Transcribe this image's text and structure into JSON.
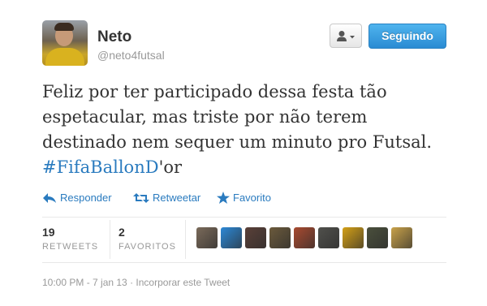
{
  "user": {
    "name": "Neto",
    "handle": "@neto4futsal"
  },
  "buttons": {
    "following": "Seguindo",
    "user_actions_icon": "person-dropdown-icon"
  },
  "tweet": {
    "text_before": "Feliz por ter participado dessa festa tão espetacular, mas triste por não terem destinado nem sequer um minuto pro Futsal. ",
    "hashtag": "#FifaBallonD",
    "text_after": "'or"
  },
  "actions": {
    "reply": "Responder",
    "retweet": "Retweetar",
    "favorite": "Favorito"
  },
  "stats": {
    "retweets_count": "19",
    "retweets_label": "RETWEETS",
    "favorites_count": "2",
    "favorites_label": "FAVORITOS"
  },
  "favoriters": [
    {
      "name": "favoriter-1",
      "color": "#7a6a5a"
    },
    {
      "name": "favoriter-2",
      "color": "#2d88d6"
    },
    {
      "name": "favoriter-3",
      "color": "#5a4038"
    },
    {
      "name": "favoriter-4",
      "color": "#6b5a3c"
    },
    {
      "name": "favoriter-5",
      "color": "#a84a30"
    },
    {
      "name": "favoriter-6",
      "color": "#50504c"
    },
    {
      "name": "favoriter-7",
      "color": "#d4a017"
    },
    {
      "name": "favoriter-8",
      "color": "#4a4f3c"
    },
    {
      "name": "favoriter-9",
      "color": "#c9a24a"
    }
  ],
  "footer": {
    "timestamp": "10:00 PM - 7 jan 13",
    "separator": "·",
    "embed": "Incorporar este Tweet"
  },
  "colors": {
    "link": "#2a7bbf",
    "button_blue": "#2a8bd3",
    "muted": "#999999",
    "text": "#333333"
  }
}
